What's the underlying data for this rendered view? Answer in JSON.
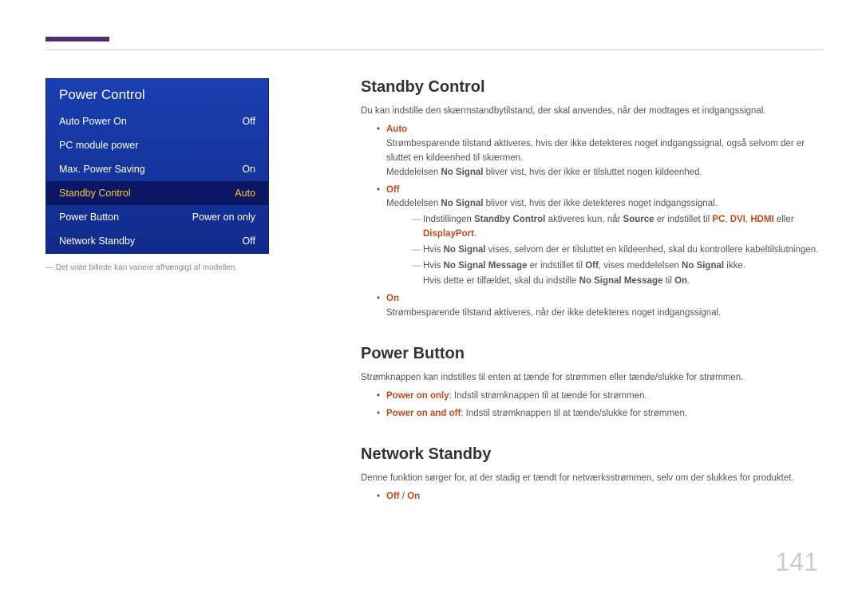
{
  "menu": {
    "title": "Power Control",
    "items": [
      {
        "label": "Auto Power On",
        "value": "Off"
      },
      {
        "label": "PC module power",
        "value": ""
      },
      {
        "label": "Max. Power Saving",
        "value": "On"
      },
      {
        "label": "Standby Control",
        "value": "Auto"
      },
      {
        "label": "Power Button",
        "value": "Power on only"
      },
      {
        "label": "Network Standby",
        "value": "Off"
      }
    ]
  },
  "caption": "― Det viste billede kan variere afhængigt af modellen.",
  "sections": {
    "standby": {
      "heading": "Standby Control",
      "intro": "Du kan indstille den skærmstandbytilstand, der skal anvendes, når der modtages et indgangssignal.",
      "auto_label": "Auto",
      "auto_p1": "Strømbesparende tilstand aktiveres, hvis der ikke detekteres noget indgangssignal, også selvom der er sluttet en kildeenhed til skærmen.",
      "auto_p2_a": "Meddelelsen ",
      "auto_p2_b": "No Signal",
      "auto_p2_c": " bliver vist, hvis der ikke er tilsluttet nogen kildeenhed.",
      "off_label": "Off",
      "off_p1_a": "Meddelelsen ",
      "off_p1_b": "No Signal",
      "off_p1_c": " bliver vist, hvis der ikke detekteres noget indgangssignal.",
      "off_note1_a": "Indstillingen ",
      "off_note1_b": "Standby Control",
      "off_note1_c": " aktiveres kun, når ",
      "off_note1_d": "Source",
      "off_note1_e": " er indstillet til ",
      "off_note1_f": "PC",
      "off_note1_g": "DVI",
      "off_note1_h": "HDMI",
      "off_note1_i": "DisplayPort",
      "off_note2_a": "Hvis ",
      "off_note2_b": "No Signal",
      "off_note2_c": " vises, selvom der er tilsluttet en kildeenhed, skal du kontrollere kabeltilslutningen.",
      "off_note3_a": "Hvis ",
      "off_note3_b": "No Signal Message",
      "off_note3_c": " er indstillet til ",
      "off_note3_d": "Off",
      "off_note3_e": ", vises meddelelsen ",
      "off_note3_f": "No Signal",
      "off_note3_g": " ikke.",
      "off_note4_a": "Hvis dette er tilfældet, skal du indstille ",
      "off_note4_b": "No Signal Message",
      "off_note4_c": " til ",
      "off_note4_d": "On",
      "on_label": "On",
      "on_p": "Strømbesparende tilstand aktiveres, når der ikke detekteres noget indgangssignal."
    },
    "powerbutton": {
      "heading": "Power Button",
      "intro": "Strømknappen kan indstilles til enten at tænde for strømmen eller tænde/slukke for strømmen.",
      "b1_a": "Power on only",
      "b1_b": ": Indstil strømknappen til at tænde for strømmen.",
      "b2_a": "Power on and off",
      "b2_b": ": Indstil strømknappen til at tænde/slukke for strømmen."
    },
    "network": {
      "heading": "Network Standby",
      "intro": "Denne funktion sørger for, at der stadig er tændt for netværksstrømmen, selv om der slukkes for produktet.",
      "opt_a": "Off",
      "opt_sep": " / ",
      "opt_b": "On"
    }
  },
  "page_number": "141"
}
